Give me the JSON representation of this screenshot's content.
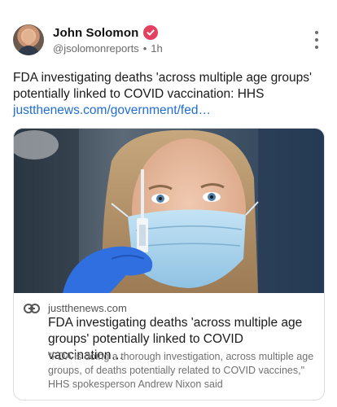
{
  "post": {
    "author_name": "John Solomon",
    "handle": "@jsolomonreports",
    "time": "1h",
    "separator": "•",
    "text": "FDA investigating deaths 'across multiple age groups' potentially linked to COVID vaccination: HHS",
    "link_text": "justthenews.com/government/fed…"
  },
  "icons": {
    "verified": "verified-check-icon",
    "more": "more-vertical-icon",
    "link": "link-icon"
  },
  "card": {
    "domain": "justthenews.com",
    "title": "FDA investigating deaths 'across multiple age groups' potentially linked to COVID vaccination…",
    "description": "\"FDA is doing a thorough investigation, across multiple age groups, of deaths potentially related to COVID vaccines,\" HHS spokesperson Andrew Nixon said"
  },
  "colors": {
    "link": "#1e6dd6",
    "verified": "#e4405f",
    "mask": "#a9d3ec",
    "glove": "#2f6fe0"
  }
}
